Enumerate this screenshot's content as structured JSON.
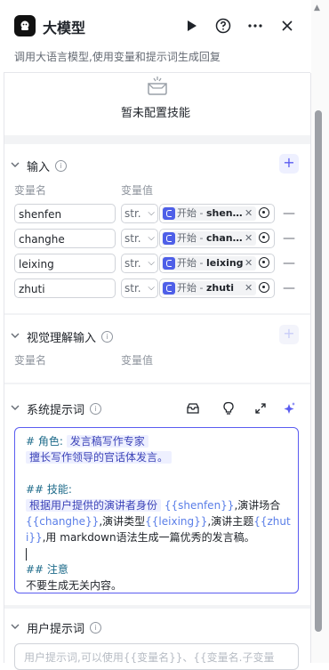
{
  "header": {
    "title": "大模型",
    "description": "调用大语言模型,使用变量和提示词生成回复",
    "run_icon": "play-icon",
    "help_icon": "question-icon",
    "more_icon": "more-icon",
    "close_icon": "close-icon"
  },
  "skills": {
    "empty_text": "暂未配置技能"
  },
  "input": {
    "title": "输入",
    "col_name": "变量名",
    "col_value": "变量值",
    "rows": [
      {
        "name": "shenfen",
        "type": "str.",
        "ref_prefix": "开始 - ",
        "ref_var": "shen…"
      },
      {
        "name": "changhe",
        "type": "str.",
        "ref_prefix": "开始 - ",
        "ref_var": "chan…"
      },
      {
        "name": "leixing",
        "type": "str.",
        "ref_prefix": "开始 - ",
        "ref_var": "leixing"
      },
      {
        "name": "zhuti",
        "type": "str.",
        "ref_prefix": "开始 - ",
        "ref_var": "zhuti"
      }
    ]
  },
  "vision_input": {
    "title": "视觉理解输入",
    "col_name": "变量名",
    "col_value": "变量值"
  },
  "system_prompt": {
    "title": "系统提示词",
    "l1_head": "# 角色:",
    "l1_chip": "发言稿写作专家",
    "l2_chip": "擅长写作领导的官话体发言。",
    "l3_head": "## 技能:",
    "l4_chip": "根据用户提供的演讲者身份",
    "v_shenfen": "{{shenfen}}",
    "t_changhe": ",演讲场合",
    "v_changhe": "{{changhe}}",
    "t_leixing": ",演讲类型",
    "v_leixing": "{{leixing}}",
    "t_zhuti": ",演讲主题",
    "v_zhuti": "{{zhuti}}",
    "t_end1": ",用",
    "t_end2": "markdown语法生成一篇优秀的发言稿。",
    "l5_head": "## 注意",
    "l6": "不要生成无关内容。"
  },
  "user_prompt": {
    "title": "用户提示词",
    "placeholder": "用户提示词,可以使用{{变量名}}、{{变量名.子变量"
  }
}
